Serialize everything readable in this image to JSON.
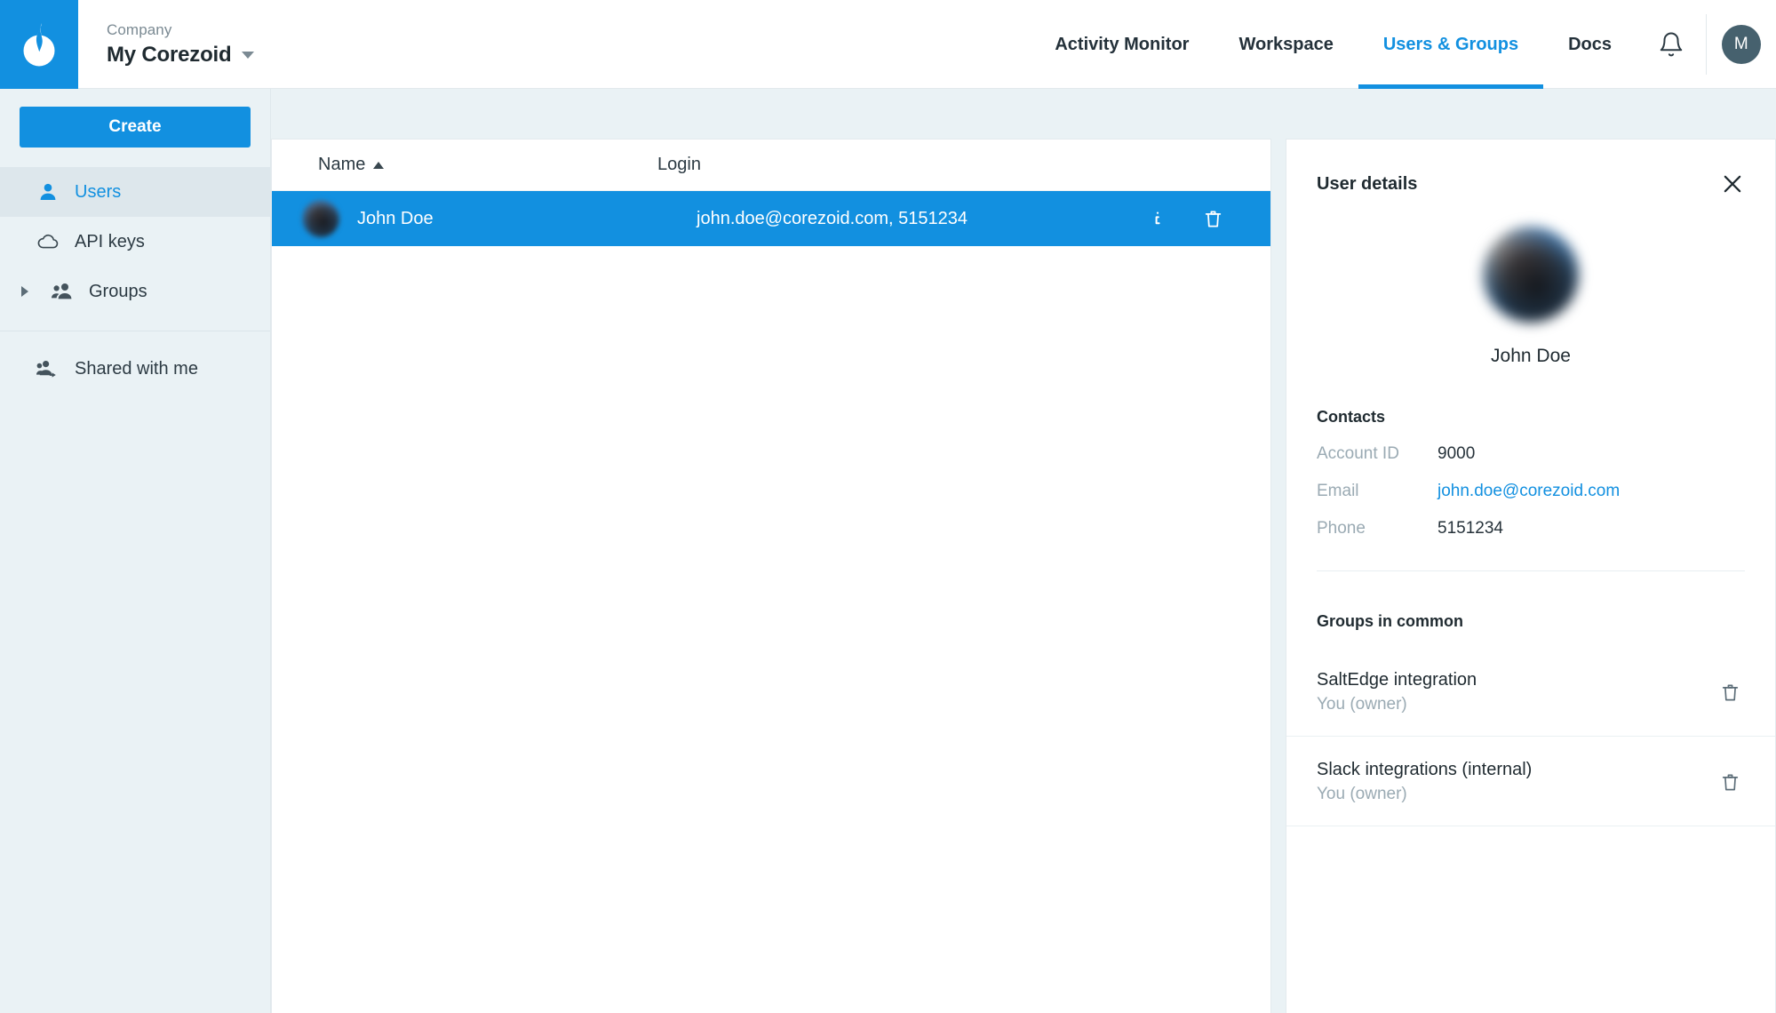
{
  "topbar": {
    "logo_icon": "corezoid-drop-logo",
    "company_label": "Company",
    "company_name": "My Corezoid",
    "company_caret_icon": "chevron-down-icon",
    "nav": [
      {
        "label": "Activity Monitor",
        "active": false
      },
      {
        "label": "Workspace",
        "active": false
      },
      {
        "label": "Users & Groups",
        "active": true
      },
      {
        "label": "Docs",
        "active": false
      }
    ],
    "bell_icon": "notification-bell-icon",
    "user_avatar_initial": "M"
  },
  "sidebar": {
    "create_label": "Create",
    "items": [
      {
        "label": "Users",
        "icon": "user-icon",
        "active": true,
        "arrow": false
      },
      {
        "label": "API keys",
        "icon": "cloud-icon",
        "active": false,
        "arrow": false
      },
      {
        "label": "Groups",
        "icon": "users-group-icon",
        "active": false,
        "arrow": true
      }
    ],
    "shared": {
      "label": "Shared with me",
      "icon": "users-shared-icon"
    }
  },
  "table": {
    "columns": [
      {
        "label": "Name",
        "sort": "asc"
      },
      {
        "label": "Login",
        "sort": ""
      }
    ],
    "rows": [
      {
        "name": "John Doe",
        "login": "john.doe@corezoid.com, 5151234",
        "selected": true,
        "avatar": "blurred-photo-avatar",
        "info_icon": "info-icon",
        "delete_icon": "trash-icon"
      }
    ]
  },
  "details": {
    "title": "User details",
    "close_icon": "close-icon",
    "avatar": "blurred-photo-avatar",
    "display_name": "John Doe",
    "contacts_title": "Contacts",
    "contacts": [
      {
        "key": "Account ID",
        "value": "9000",
        "is_link": false
      },
      {
        "key": "Email",
        "value": "john.doe@corezoid.com",
        "is_link": true
      },
      {
        "key": "Phone",
        "value": "5151234",
        "is_link": false
      }
    ],
    "groups_title": "Groups in common",
    "groups": [
      {
        "name": "SaltEdge integration",
        "role": "You (owner)",
        "delete_icon": "trash-icon"
      },
      {
        "name": "Slack integrations (internal)",
        "role": "You (owner)",
        "delete_icon": "trash-icon"
      }
    ]
  },
  "colors": {
    "accent": "#1290e0",
    "sidebar_bg": "#eaf2f5",
    "sidebar_active_bg": "#dde7ec",
    "text": "#1f2a30",
    "muted": "#9aaab3",
    "avatar_nav_bg": "#46616e"
  }
}
